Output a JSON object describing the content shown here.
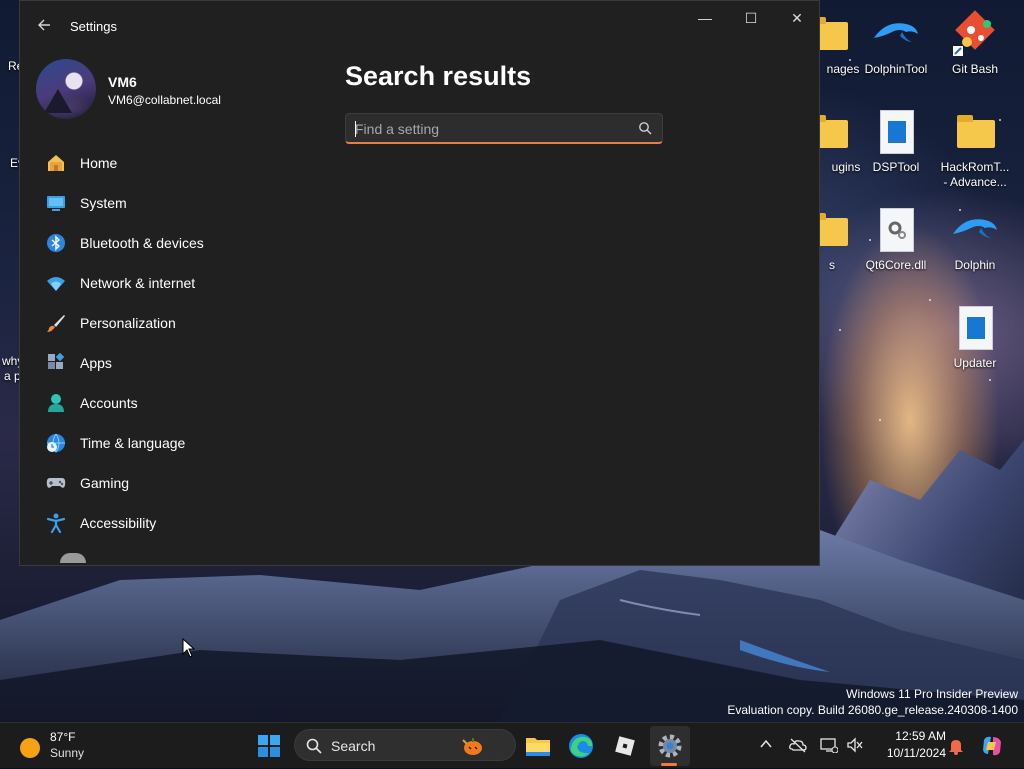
{
  "desktop": {
    "icons": [
      {
        "label": "DolphinTool",
        "icon": "dolphin-icon"
      },
      {
        "label": "Git Bash",
        "icon": "git-bash-icon"
      },
      {
        "label": "DSPTool",
        "icon": "app-window-icon"
      },
      {
        "label": "HackRomT...\n- Advance...",
        "icon": "folder-icon"
      },
      {
        "label": "Qt6Core.dll",
        "icon": "dll-file-icon"
      },
      {
        "label": "Dolphin",
        "icon": "dolphin-icon"
      },
      {
        "label": "Updater",
        "icon": "app-window-icon"
      }
    ],
    "partial_labels": [
      "nages",
      "ugins",
      "s",
      "Re",
      "Ev",
      "why",
      "a p"
    ],
    "watermark": {
      "line1": "Windows 11 Pro Insider Preview",
      "line2": "Evaluation copy. Build 26080.ge_release.240308-1400"
    }
  },
  "window": {
    "title": "Settings",
    "controls": {
      "minimize": "—",
      "maximize": "☐",
      "close": "✕"
    },
    "profile": {
      "name": "VM6",
      "email": "VM6@collabnet.local"
    },
    "nav": [
      {
        "label": "Home",
        "icon": "home-icon"
      },
      {
        "label": "System",
        "icon": "system-icon"
      },
      {
        "label": "Bluetooth & devices",
        "icon": "bluetooth-icon"
      },
      {
        "label": "Network & internet",
        "icon": "wifi-icon"
      },
      {
        "label": "Personalization",
        "icon": "brush-icon"
      },
      {
        "label": "Apps",
        "icon": "apps-icon"
      },
      {
        "label": "Accounts",
        "icon": "accounts-icon"
      },
      {
        "label": "Time & language",
        "icon": "globe-clock-icon"
      },
      {
        "label": "Gaming",
        "icon": "gamepad-icon"
      },
      {
        "label": "Accessibility",
        "icon": "accessibility-icon"
      }
    ],
    "page_title": "Search results",
    "search": {
      "placeholder": "Find a setting",
      "value": ""
    },
    "accent": "#f07b3f"
  },
  "taskbar": {
    "weather": {
      "temp": "87°F",
      "condition": "Sunny"
    },
    "search_label": "Search",
    "apps": [
      "start-icon",
      "file-explorer-icon",
      "edge-icon",
      "roblox-icon",
      "settings-icon"
    ],
    "tray": [
      "chevron-up-icon",
      "onedrive-icon",
      "network-icon",
      "volume-muted-icon"
    ],
    "clock": {
      "time": "12:59 AM",
      "date": "10/11/2024"
    }
  }
}
